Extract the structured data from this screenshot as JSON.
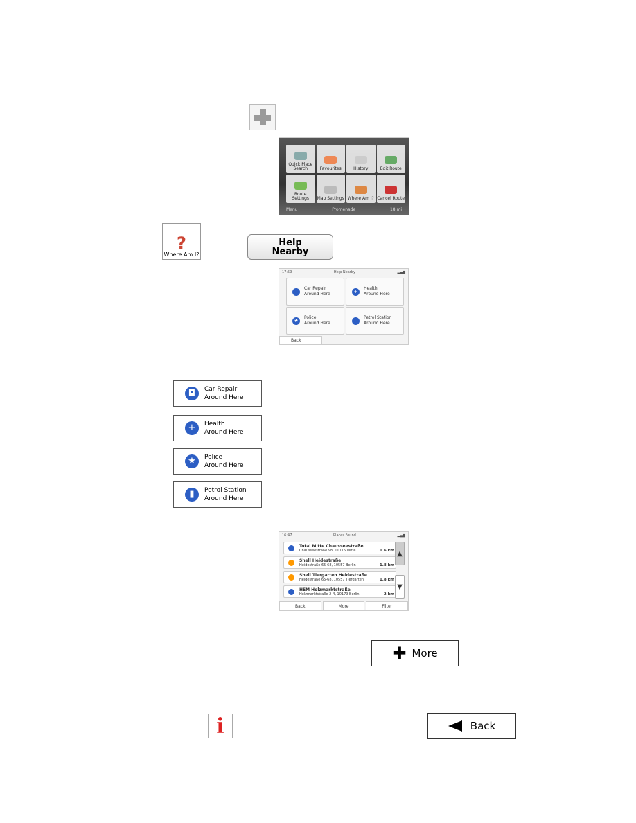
{
  "plus_icon": "plus-icon",
  "menu_screen": {
    "header": "Promenade",
    "tiles": [
      "Quick Place Search",
      "Favourites",
      "History",
      "Edit Route",
      "Route Settings",
      "Map Settings",
      "Where Am I?",
      "Cancel Route"
    ],
    "menu": "Menu",
    "street": "Promenade",
    "distance": "18 mi"
  },
  "where_am_i_icon": {
    "label": "Where Am I?"
  },
  "help_nearby_button": {
    "line1": "Help",
    "line2": "Nearby"
  },
  "help_nearby_screen": {
    "time": "17:59",
    "title": "Help Nearby",
    "tiles": [
      {
        "l1": "Car Repair",
        "l2": "Around Here"
      },
      {
        "l1": "Health",
        "l2": "Around Here"
      },
      {
        "l1": "Police",
        "l2": "Around Here"
      },
      {
        "l1": "Petrol Station",
        "l2": "Around Here"
      }
    ],
    "back": "Back"
  },
  "category_buttons": [
    {
      "l1": "Car Repair",
      "l2": "Around Here",
      "icon": "car-icon"
    },
    {
      "l1": "Health",
      "l2": "Around Here",
      "icon": "cross-icon"
    },
    {
      "l1": "Police",
      "l2": "Around Here",
      "icon": "star-icon"
    },
    {
      "l1": "Petrol Station",
      "l2": "Around Here",
      "icon": "fuel-icon"
    }
  ],
  "places_found_screen": {
    "time": "16:47",
    "title": "Places Found",
    "rows": [
      {
        "name": "Total Mitte Chausseestraße",
        "addr": "Chausseestraße 98, 10115 Mitte",
        "dist": "1.6 km"
      },
      {
        "name": "Shell Heidestraße",
        "addr": "Heidestraße 65-68, 10557 Berlin",
        "dist": "1.8 km"
      },
      {
        "name": "Shell Tiergarten Heidestraße",
        "addr": "Heidestraße 65-68, 10557 Tiergarten",
        "dist": "1.8 km"
      },
      {
        "name": "HEM Holzmarktstraße",
        "addr": "Holzmarktstraße 2-4, 10179 Berlin",
        "dist": "2 km"
      }
    ],
    "tabs": [
      "Back",
      "More",
      "Filter"
    ]
  },
  "more_button": "More",
  "info_icon": "i",
  "back_button": "Back"
}
